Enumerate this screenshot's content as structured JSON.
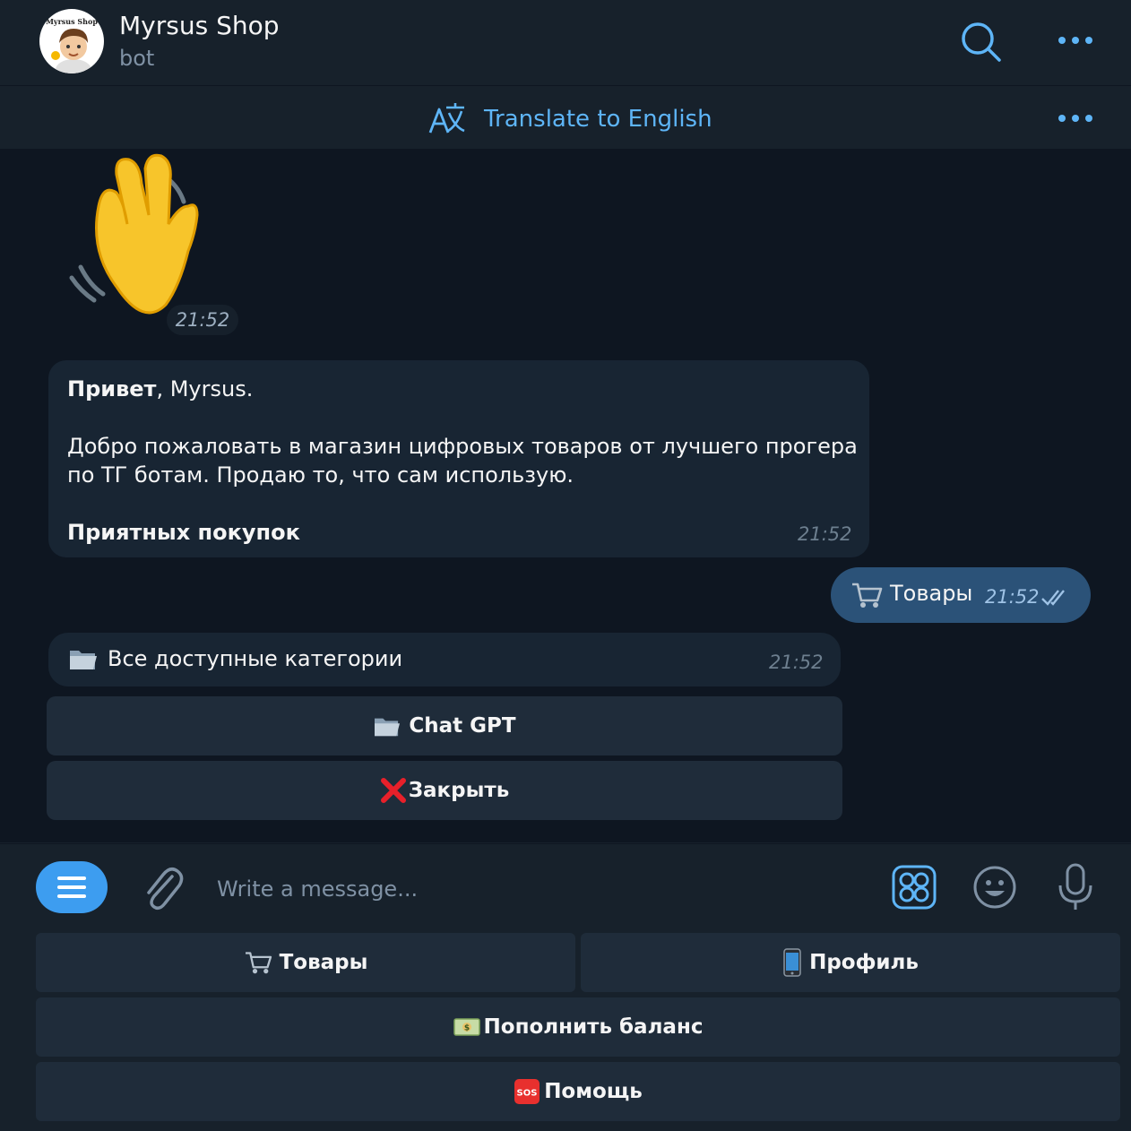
{
  "header": {
    "avatar_text": "Myrsus Shop",
    "title": "Myrsus Shop",
    "subtitle": "bot"
  },
  "translate": {
    "label": "Translate to English"
  },
  "sticker": {
    "time": "21:52"
  },
  "welcome": {
    "greeting_bold": "Привет",
    "greeting_rest": ", Myrsus.",
    "line2": "Добро пожаловать в магазин цифровых товаров от лучшего прогера",
    "line3": "по ТГ ботам. Продаю то, что сам использую.",
    "line4": "Приятных покупок",
    "time": "21:52"
  },
  "outgoing": {
    "text": "Товары",
    "time": "21:52"
  },
  "categories": {
    "text": "Все доступные категории",
    "time": "21:52"
  },
  "inline_buttons": [
    {
      "label": "Chat GPT",
      "icon": "folder-icon"
    },
    {
      "label": "Закрыть",
      "icon": "red-x-icon"
    }
  ],
  "composer": {
    "placeholder": "Write a message..."
  },
  "keyboard": [
    {
      "label": "Товары",
      "icon": "cart-icon"
    },
    {
      "label": "Профиль",
      "icon": "phone-icon"
    },
    {
      "label": "Пополнить баланс",
      "icon": "money-icon"
    },
    {
      "label": "Помощь",
      "icon": "sos-icon"
    }
  ],
  "colors": {
    "accent": "#5eb5f7",
    "menu_button": "#3d9df0",
    "outgoing_bubble": "#2b5278",
    "incoming_bubble": "#182533"
  }
}
